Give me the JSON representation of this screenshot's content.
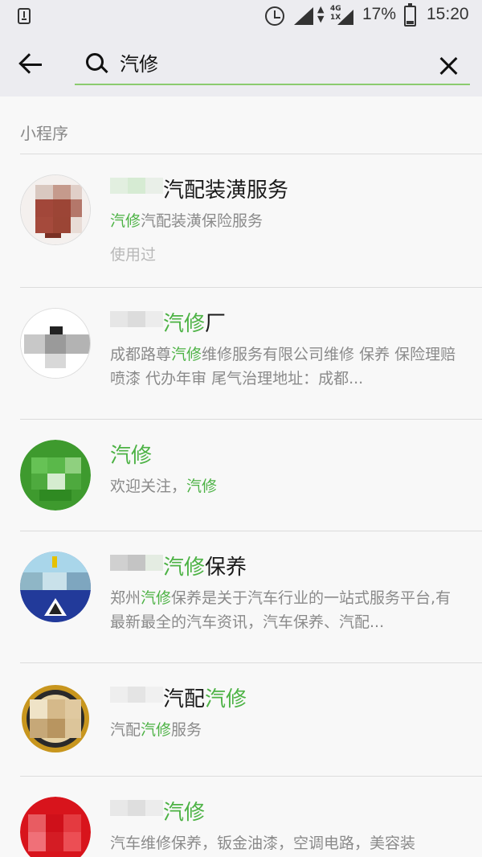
{
  "status_bar": {
    "network": "4G",
    "network_sub": "1X",
    "battery": "17%",
    "time": "15:20",
    "icons": [
      "download-icon",
      "alarm-icon",
      "signal-icon",
      "data-arrows-icon",
      "signal-icon",
      "battery-icon"
    ]
  },
  "search": {
    "query": "汽修",
    "back_icon": "arrow-left-icon",
    "search_icon": "search-icon",
    "clear_icon": "close-icon"
  },
  "section": {
    "title": "小程序"
  },
  "results": [
    {
      "title_pre": "",
      "title_hl": "",
      "title_post": "汽配装潢服务",
      "desc_hl": "汽修",
      "desc_rest": "汽配装潢保险服务",
      "used": "使用过"
    },
    {
      "title_pre": "",
      "title_hl": "汽修",
      "title_post": "厂",
      "desc_pre": "成都路尊",
      "desc_hl": "汽修",
      "desc_rest": "维修服务有限公司维修 保养 保险理赔 喷漆 代办年审 尾气治理地址：成都..."
    },
    {
      "title_hl": "汽修",
      "desc_pre": "欢迎关注，",
      "desc_hl": "汽修"
    },
    {
      "title_hl": "汽修",
      "title_post": "保养",
      "desc_pre": "郑州",
      "desc_hl": "汽修",
      "desc_rest": "保养是关于汽车行业的一站式服务平台,有最新最全的汽车资讯，汽车保养、汽配..."
    },
    {
      "title_pre": "汽配",
      "title_hl": "汽修",
      "desc_pre": "汽配",
      "desc_hl": "汽修",
      "desc_rest": "服务"
    },
    {
      "title_hl": "汽修",
      "desc_rest": "汽车维修保养，钣金油漆，空调电路，美容装"
    }
  ],
  "colors": {
    "highlight": "#4cb244",
    "search_underline": "#8bcb6f",
    "background": "#f8f8f8",
    "header_bg": "#ececf0"
  }
}
